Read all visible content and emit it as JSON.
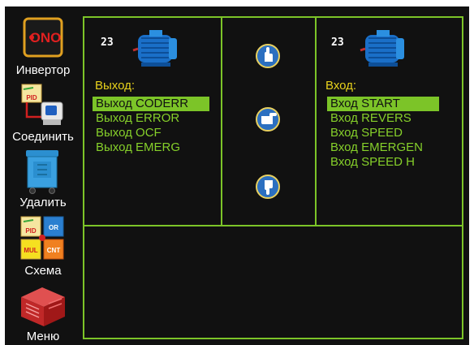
{
  "colors": {
    "background": "#111111",
    "accent_green": "#7cc428",
    "list_text": "#86d02a",
    "heading_yellow": "#e8d21c",
    "selected_bg": "#7cc428"
  },
  "sidebar": {
    "items": [
      {
        "label": "Инвертор",
        "icon": "ono-icon",
        "icon_text": "ONO"
      },
      {
        "label": "Соединить",
        "icon": "pid-connect-icon",
        "icon_text": "PID"
      },
      {
        "label": "Удалить",
        "icon": "trash-bin-icon"
      },
      {
        "label": "Схема",
        "icon": "scheme-blocks-icon",
        "blocks": [
          "PID",
          "OR",
          "MUL",
          "CNT"
        ]
      },
      {
        "label": "Меню",
        "icon": "menu-box-icon"
      }
    ]
  },
  "left_panel": {
    "count": "23",
    "icon": "motor-icon",
    "title": "Выход:",
    "items": [
      {
        "label": "Выход CODERR",
        "selected": true
      },
      {
        "label": "Выход ERROR",
        "selected": false
      },
      {
        "label": "Выход OCF",
        "selected": false
      },
      {
        "label": "Выход EMERG",
        "selected": false
      }
    ]
  },
  "center_panel": {
    "buttons": [
      {
        "icon": "hand-up-icon"
      },
      {
        "icon": "hand-right-icon"
      },
      {
        "icon": "hand-down-icon"
      }
    ]
  },
  "right_panel": {
    "count": "23",
    "icon": "motor-icon",
    "title": "Вход:",
    "items": [
      {
        "label": "Вход START",
        "selected": true
      },
      {
        "label": "Вход REVERS",
        "selected": false
      },
      {
        "label": "Вход SPEED",
        "selected": false
      },
      {
        "label": "Вход EMERGEN",
        "selected": false
      },
      {
        "label": "Вход SPEED H",
        "selected": false
      }
    ]
  }
}
